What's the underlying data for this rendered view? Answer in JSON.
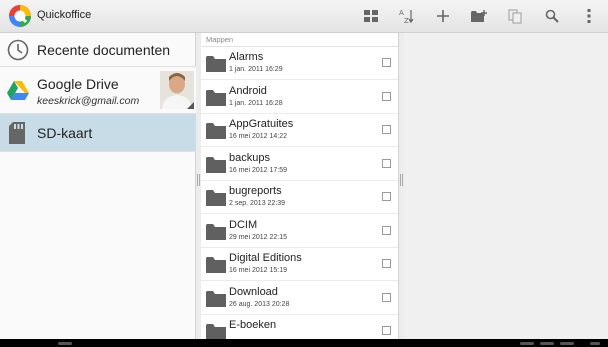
{
  "app": {
    "title": "Quickoffice",
    "logo_icon": "quickoffice-logo"
  },
  "toolbar": {
    "buttons": [
      {
        "name": "view-toggle-button",
        "icon": "grid-view-icon"
      },
      {
        "name": "sort-button",
        "icon": "sort-az-icon"
      },
      {
        "name": "new-button",
        "icon": "plus-icon"
      },
      {
        "name": "new-folder-button",
        "icon": "new-folder-icon"
      },
      {
        "name": "copy-button",
        "icon": "copy-icon"
      },
      {
        "name": "search-button",
        "icon": "search-icon"
      },
      {
        "name": "overflow-menu-button",
        "icon": "more-vert-icon"
      }
    ]
  },
  "sidebar": {
    "items": [
      {
        "label": "Recente documenten",
        "icon": "clock-icon"
      },
      {
        "label": "Google Drive",
        "account": "keeskrick@gmail.com",
        "icon": "google-drive-icon"
      },
      {
        "label": "SD-kaart",
        "icon": "sd-card-icon",
        "selected": true
      }
    ]
  },
  "folders": {
    "header": "Mappen",
    "items": [
      {
        "name": "Alarms",
        "date": "1 jan. 2011 16:29"
      },
      {
        "name": "Android",
        "date": "1 jan. 2011 16:28"
      },
      {
        "name": "AppGratuites",
        "date": "16 mei 2012 14:22"
      },
      {
        "name": "backups",
        "date": "16 mei 2012 17:59"
      },
      {
        "name": "bugreports",
        "date": "2 sep. 2013 22:39"
      },
      {
        "name": "DCIM",
        "date": "29 mei 2012 22:15"
      },
      {
        "name": "Digital Editions",
        "date": "16 mei 2012 15:19"
      },
      {
        "name": "Download",
        "date": "26 aug. 2013 20:28"
      },
      {
        "name": "E-boeken",
        "date": ""
      }
    ]
  },
  "colors": {
    "selected_bg": "#c8dce8",
    "folder_icon": "#606060"
  }
}
